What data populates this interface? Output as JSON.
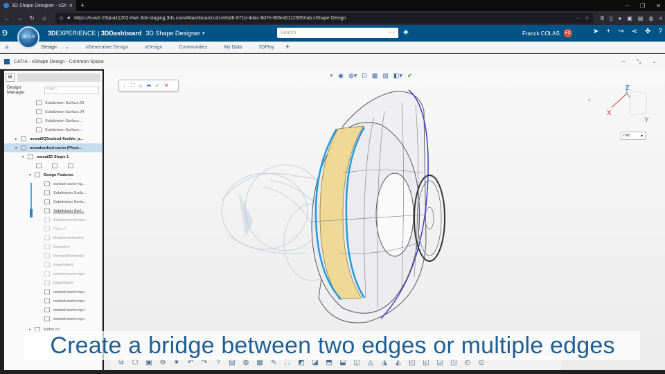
{
  "browser": {
    "tab_title": "3D Shape Designer - xShape De...",
    "url": "https://euw1-23qna11202-ifwe.3dx-staging.3ds.com/#dashboard:cd1eebd6-071b-4dac-8d7e-80fea5112365/tab:xShape Design"
  },
  "appbar": {
    "brand_prefix": "3D",
    "brand_main": "EXPERIENCE",
    "separator": " | ",
    "dashboard": "3DDashboard",
    "app_name": "3D Shape Designer",
    "search_placeholder": "Search",
    "user_name": "Franck COLAS",
    "user_initials": "FC"
  },
  "subtabs": {
    "items": [
      "Design",
      "xGenerative Design",
      "xDesign",
      "Communities",
      "My Data",
      "3DPlay"
    ]
  },
  "session": {
    "title": "CATIA - xShape Design - Common Space"
  },
  "leftpanel": {
    "manager_label": "Design Manager",
    "filter_placeholder": "Find ...",
    "nodes": [
      {
        "label": "Subdivision Surface.23"
      },
      {
        "label": "Subdivision Surface.24"
      },
      {
        "label": "Subdivision Surface...."
      },
      {
        "label": "Subdivision Surface...."
      },
      {
        "label": "nomat9Q5earbud-flexible_p..."
      },
      {
        "label": "nomatearbud-cache (Physi..."
      },
      {
        "label": "nomat3D Shape 1"
      },
      {
        "label": "Design Features"
      },
      {
        "label": "earbud-cache-ng..."
      },
      {
        "label": "Subdivision Surfa..."
      },
      {
        "label": "Subdivision Surfa..."
      },
      {
        "label": "Subdivision Surf..."
      },
      {
        "label": "Subdivision Surfa..."
      },
      {
        "label": "Plane.1"
      },
      {
        "label": "Multiple Extrude.1"
      },
      {
        "label": "Extrude.1"
      },
      {
        "label": "OrientedRefined.1"
      },
      {
        "label": "EdgeFillet.1"
      },
      {
        "label": "earbud-cache-ng..."
      },
      {
        "label": "EdgeFillet.2"
      },
      {
        "label": "earbud-cache-ng..."
      },
      {
        "label": "earbud-cache-ng..."
      },
      {
        "label": "earbud-cache-ng..."
      },
      {
        "label": "earbud-cache-ng..."
      },
      {
        "label": "button on"
      }
    ]
  },
  "viewport": {
    "unit": "mm",
    "axis_x": "X",
    "axis_y": "Y",
    "axis_z": "Z"
  },
  "caption": "Create a bridge between two edges or multiple edges"
}
